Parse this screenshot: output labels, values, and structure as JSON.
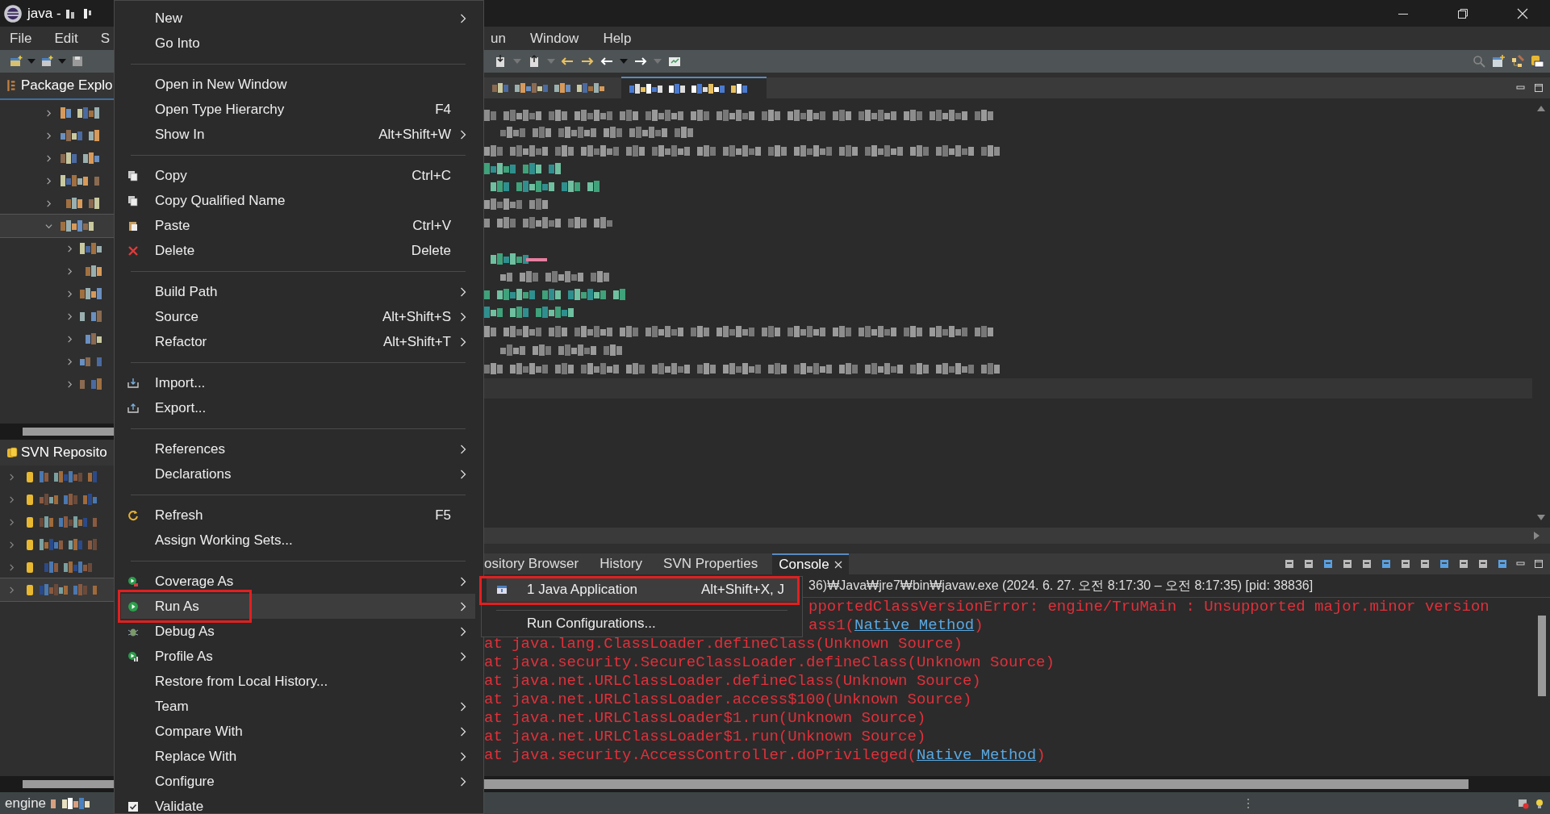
{
  "window": {
    "title": "java - "
  },
  "menu_bar": {
    "left": [
      "File",
      "Edit",
      "S"
    ],
    "right": [
      "un",
      "Window",
      "Help"
    ]
  },
  "package_explorer": {
    "title": "Package Explo",
    "items": [
      {
        "expanded": false,
        "selected": false
      },
      {
        "expanded": false,
        "selected": false
      },
      {
        "expanded": false,
        "selected": false
      },
      {
        "expanded": false,
        "selected": false
      },
      {
        "expanded": false,
        "selected": false
      },
      {
        "expanded": true,
        "selected": true,
        "children": [
          {
            "expanded": false,
            "selected": false
          },
          {
            "expanded": false,
            "selected": false
          },
          {
            "expanded": false,
            "selected": false
          },
          {
            "expanded": false,
            "selected": false
          },
          {
            "expanded": false,
            "selected": false
          },
          {
            "expanded": false,
            "selected": false
          },
          {
            "expanded": false,
            "selected": false
          }
        ]
      }
    ]
  },
  "svn_repositories": {
    "title": "SVN Reposito",
    "items": [
      {
        "expanded": false,
        "selected": false
      },
      {
        "expanded": false,
        "selected": false
      },
      {
        "expanded": false,
        "selected": false
      },
      {
        "expanded": false,
        "selected": false
      },
      {
        "expanded": false,
        "selected": false
      },
      {
        "expanded": false,
        "selected": true
      }
    ]
  },
  "context_menu": {
    "items": [
      {
        "kind": "item",
        "label": "New",
        "submenu": true,
        "selected": false
      },
      {
        "kind": "item",
        "label": "Go Into",
        "selected": false
      },
      {
        "kind": "separator"
      },
      {
        "kind": "item",
        "label": "Open in New Window",
        "selected": false
      },
      {
        "kind": "item",
        "label": "Open Type Hierarchy",
        "shortcut": "F4",
        "selected": false
      },
      {
        "kind": "item",
        "label": "Show In",
        "shortcut": "Alt+Shift+W",
        "submenu": true,
        "selected": false
      },
      {
        "kind": "separator"
      },
      {
        "kind": "item",
        "label": "Copy",
        "shortcut": "Ctrl+C",
        "selected": false
      },
      {
        "kind": "item",
        "label": "Copy Qualified Name",
        "selected": false
      },
      {
        "kind": "item",
        "label": "Paste",
        "shortcut": "Ctrl+V",
        "selected": false
      },
      {
        "kind": "item",
        "label": "Delete",
        "shortcut": "Delete",
        "selected": false
      },
      {
        "kind": "separator"
      },
      {
        "kind": "item",
        "label": "Build Path",
        "submenu": true,
        "selected": false
      },
      {
        "kind": "item",
        "label": "Source",
        "shortcut": "Alt+Shift+S",
        "submenu": true,
        "selected": false
      },
      {
        "kind": "item",
        "label": "Refactor",
        "shortcut": "Alt+Shift+T",
        "submenu": true,
        "selected": false
      },
      {
        "kind": "separator"
      },
      {
        "kind": "item",
        "label": "Import...",
        "selected": false
      },
      {
        "kind": "item",
        "label": "Export...",
        "selected": false
      },
      {
        "kind": "separator"
      },
      {
        "kind": "item",
        "label": "References",
        "submenu": true,
        "selected": false
      },
      {
        "kind": "item",
        "label": "Declarations",
        "submenu": true,
        "selected": false
      },
      {
        "kind": "separator"
      },
      {
        "kind": "item",
        "label": "Refresh",
        "shortcut": "F5",
        "selected": false
      },
      {
        "kind": "item",
        "label": "Assign Working Sets...",
        "selected": false
      },
      {
        "kind": "separator"
      },
      {
        "kind": "item",
        "label": "Coverage As",
        "submenu": true,
        "selected": false
      },
      {
        "kind": "item",
        "label": "Run As",
        "submenu": true,
        "selected": true,
        "red_box": true
      },
      {
        "kind": "item",
        "label": "Debug As",
        "submenu": true,
        "selected": false
      },
      {
        "kind": "item",
        "label": "Profile As",
        "submenu": true,
        "selected": false
      },
      {
        "kind": "item",
        "label": "Restore from Local History...",
        "selected": false
      },
      {
        "kind": "item",
        "label": "Team",
        "submenu": true,
        "selected": false
      },
      {
        "kind": "item",
        "label": "Compare With",
        "submenu": true,
        "selected": false
      },
      {
        "kind": "item",
        "label": "Replace With",
        "submenu": true,
        "selected": false
      },
      {
        "kind": "item",
        "label": "Configure",
        "submenu": true,
        "selected": false
      },
      {
        "kind": "item",
        "label": "Validate",
        "selected": false
      }
    ]
  },
  "run_as_submenu": {
    "items": [
      {
        "kind": "item",
        "label": "1 Java Application",
        "shortcut": "Alt+Shift+X, J",
        "selected": true,
        "red_box": true
      },
      {
        "kind": "separator"
      },
      {
        "kind": "item",
        "label": "Run Configurations...",
        "selected": false
      }
    ]
  },
  "console": {
    "tabs": [
      {
        "label": "ository Browser",
        "selected": false
      },
      {
        "label": "History",
        "selected": false
      },
      {
        "label": "SVN Properties",
        "selected": false
      },
      {
        "label": "Console",
        "selected": true,
        "closable": true
      }
    ],
    "header": "36)₩Java₩jre7₩bin₩javaw.exe  (2024. 6. 27. 오전 8:17:30 – 오전 8:17:35) [pid: 38836]",
    "lines": [
      {
        "hidden_start": true,
        "segments": [
          {
            "text": "pportedClassVersionError: engine/TruMain : Unsupported major.minor version",
            "link": false
          }
        ]
      },
      {
        "hidden_start": true,
        "segments": [
          {
            "text": "ass1(",
            "link": false
          },
          {
            "text": "Native Method",
            "link": true
          },
          {
            "text": ")",
            "link": false
          }
        ]
      },
      {
        "hidden_start": false,
        "segments": [
          {
            "text": "at java.lang.ClassLoader.defineClass(Unknown Source)",
            "link": false
          }
        ]
      },
      {
        "hidden_start": false,
        "segments": [
          {
            "text": "at java.security.SecureClassLoader.defineClass(Unknown Source)",
            "link": false
          }
        ]
      },
      {
        "hidden_start": false,
        "segments": [
          {
            "text": "at java.net.URLClassLoader.defineClass(Unknown Source)",
            "link": false
          }
        ]
      },
      {
        "hidden_start": false,
        "segments": [
          {
            "text": "at java.net.URLClassLoader.access$100(Unknown Source)",
            "link": false
          }
        ]
      },
      {
        "hidden_start": false,
        "segments": [
          {
            "text": "at java.net.URLClassLoader$1.run(Unknown Source)",
            "link": false
          }
        ]
      },
      {
        "hidden_start": false,
        "segments": [
          {
            "text": "at java.net.URLClassLoader$1.run(Unknown Source)",
            "link": false
          }
        ]
      },
      {
        "hidden_start": false,
        "segments": [
          {
            "text": "at java.security.AccessController.doPrivileged(",
            "link": false
          },
          {
            "text": "Native Method",
            "link": true
          },
          {
            "text": ")",
            "link": false
          }
        ]
      }
    ]
  },
  "status_bar": {
    "text": "engine"
  }
}
